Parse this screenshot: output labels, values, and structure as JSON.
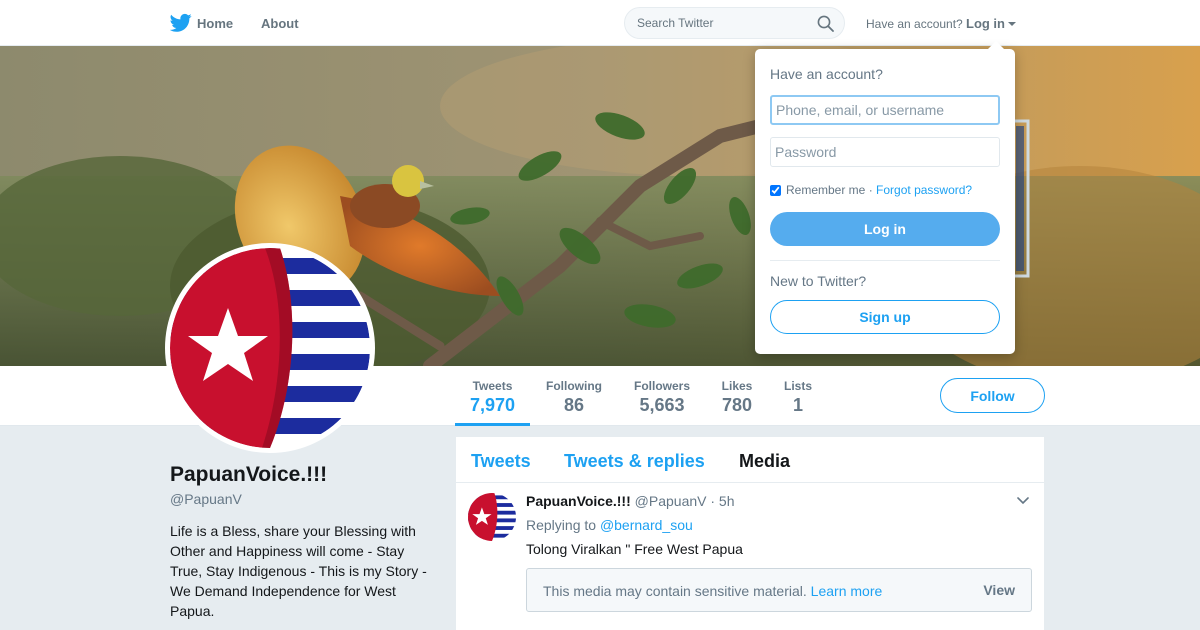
{
  "nav": {
    "home_label": "Home",
    "about_label": "About",
    "search_placeholder": "Search Twitter",
    "have_account_text": "Have an account?",
    "login_label": "Log in",
    "logo_icon": "twitter-bird-icon",
    "search_icon": "search-icon"
  },
  "colors": {
    "accent": "#1da1f2",
    "login_button": "#55acee",
    "background": "#e6ecf0",
    "flag_red": "#c8102e",
    "flag_blue": "#1c2c9e"
  },
  "profile": {
    "name": "PapuanVoice.!!!",
    "handle": "@PapuanV",
    "bio": "Life is a Bless, share your Blessing with Other and Happiness will come - Stay True, Stay Indigenous - This is my Story - We Demand Independence for West Papua."
  },
  "stats": [
    {
      "label": "Tweets",
      "value": "7,970"
    },
    {
      "label": "Following",
      "value": "86"
    },
    {
      "label": "Followers",
      "value": "5,663"
    },
    {
      "label": "Likes",
      "value": "780"
    },
    {
      "label": "Lists",
      "value": "1"
    }
  ],
  "follow_label": "Follow",
  "tabs": [
    {
      "label": "Tweets"
    },
    {
      "label": "Tweets & replies"
    },
    {
      "label": "Media"
    }
  ],
  "tweet": {
    "name": "PapuanVoice.!!!",
    "handle": "@PapuanV",
    "time": "· 5h",
    "replying_prefix": "Replying to",
    "replying_to": "@bernard_sou",
    "text": "Tolong Viralkan \" Free West Papua",
    "sensitive_message": "This media may contain sensitive material.",
    "learn_more": "Learn more",
    "view_label": "View"
  },
  "login_dropdown": {
    "title": "Have an account?",
    "username_placeholder": "Phone, email, or username",
    "password_placeholder": "Password",
    "remember_me": "Remember me",
    "separator": "·",
    "forgot_password": "Forgot password?",
    "login_button": "Log in",
    "new_to_twitter": "New to Twitter?",
    "signup_button": "Sign up"
  }
}
